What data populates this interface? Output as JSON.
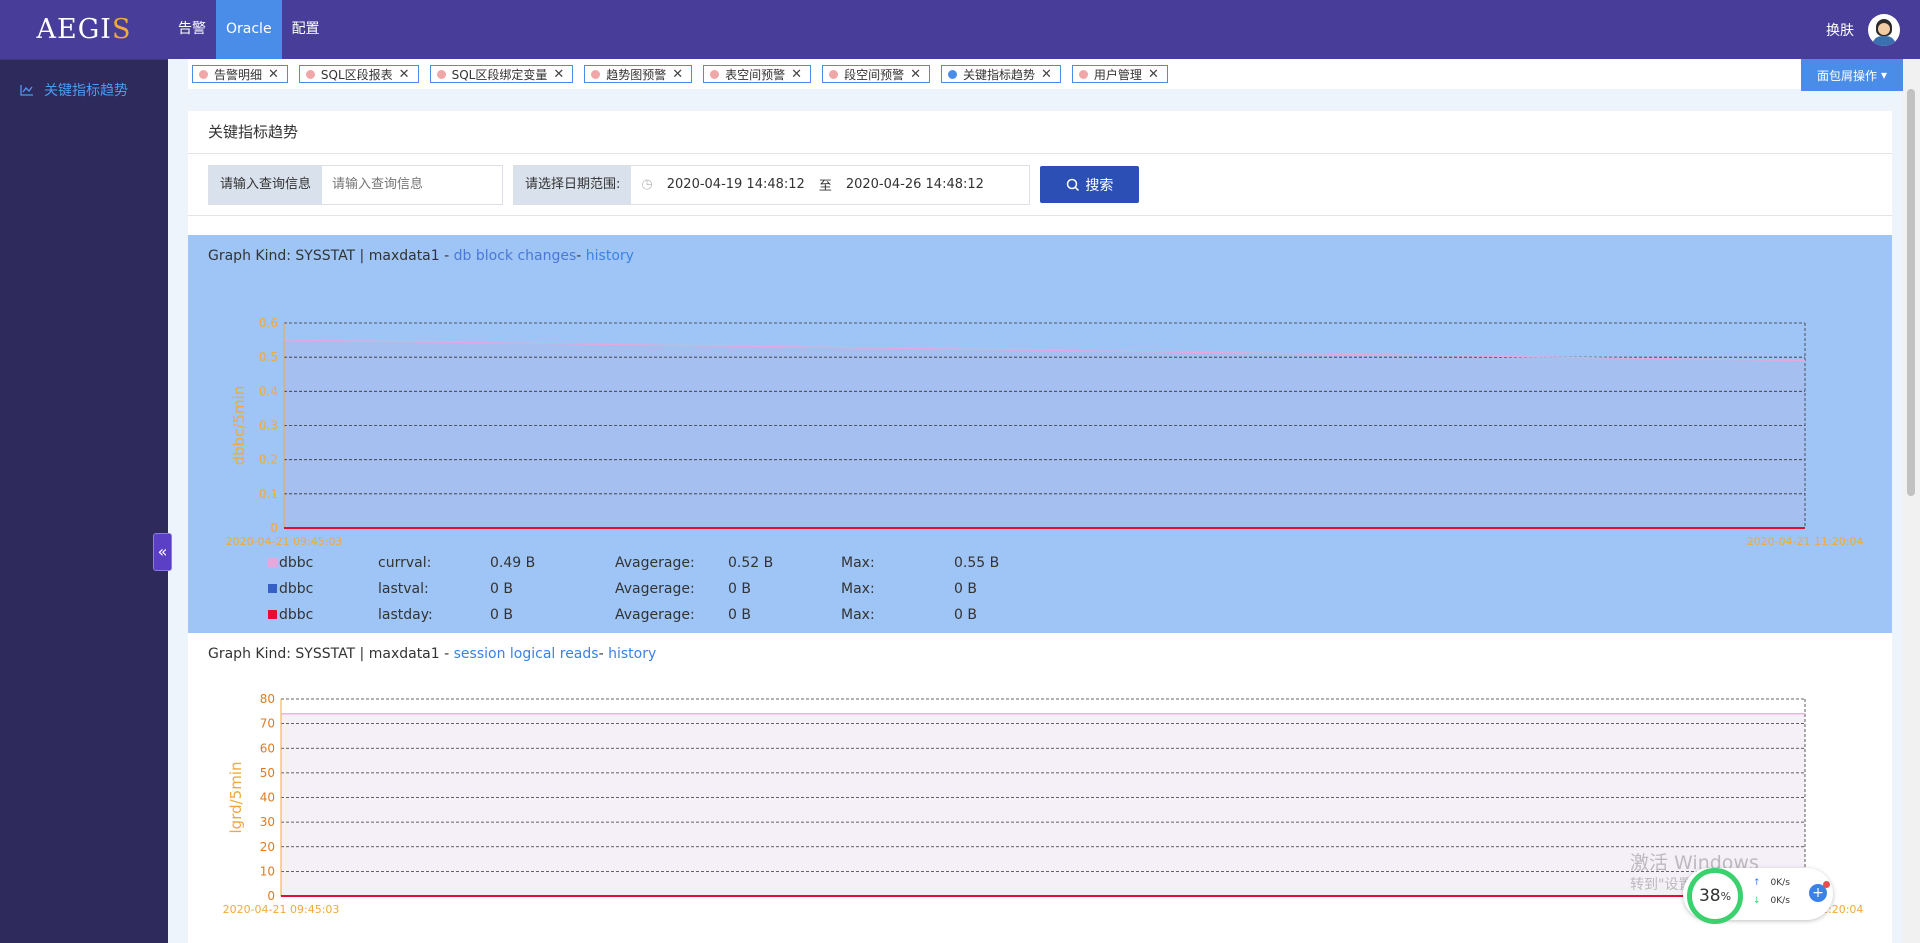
{
  "app": {
    "logo_main": "AEGI",
    "logo_s": "S"
  },
  "topnav": {
    "items": [
      {
        "label": "告警",
        "active": false
      },
      {
        "label": "Oracle",
        "active": true
      },
      {
        "label": "配置",
        "active": false
      }
    ],
    "skin_label": "换肤"
  },
  "sidebar": {
    "items": [
      {
        "label": "关键指标趋势",
        "icon": "line-chart-icon"
      }
    ],
    "collapse_glyph": "«"
  },
  "tabs": [
    {
      "label": "告警明细",
      "active": false
    },
    {
      "label": "SQL区段报表",
      "active": false
    },
    {
      "label": "SQL区段绑定变量",
      "active": false
    },
    {
      "label": "趋势图预警",
      "active": false
    },
    {
      "label": "表空间预警",
      "active": false
    },
    {
      "label": "段空间预警",
      "active": false
    },
    {
      "label": "关键指标趋势",
      "active": true
    },
    {
      "label": "用户管理",
      "active": false
    }
  ],
  "tab_close_glyph": "✕",
  "package_button": "面包屑操作",
  "panel": {
    "title": "关键指标趋势",
    "query_label": "请输入查询信息",
    "query_placeholder": "请输入查询信息",
    "date_label": "请选择日期范围:",
    "date_start": "2020-04-19 14:48:12",
    "date_sep": "至",
    "date_end": "2020-04-26 14:48:12",
    "search_button": "搜索"
  },
  "graph1": {
    "prefix": "Graph Kind: SYSSTAT | maxdata1 - ",
    "metric": "db block changes",
    "dash": "- ",
    "history": "history",
    "legend": [
      {
        "name": "dbbc",
        "color": "#e6a9d9",
        "k1": "currval:",
        "v1": "0.49 B",
        "k2": "Avagerage:",
        "v2": "0.52 B",
        "k3": "Max:",
        "v3": "0.55 B"
      },
      {
        "name": "dbbc",
        "color": "#3560c8",
        "k1": "lastval:",
        "v1": "0 B",
        "k2": "Avagerage:",
        "v2": "0 B",
        "k3": "Max:",
        "v3": "0 B"
      },
      {
        "name": "dbbc",
        "color": "#e0102e",
        "k1": "lastday:",
        "v1": "0 B",
        "k2": "Avagerage:",
        "v2": "0 B",
        "k3": "Max:",
        "v3": "0 B"
      }
    ]
  },
  "graph2": {
    "prefix": "Graph Kind: SYSSTAT | maxdata1 - ",
    "metric": "session logical reads",
    "dash": "- ",
    "history": "history"
  },
  "chart_data": [
    {
      "type": "line",
      "ylabel": "dbbc/5min",
      "ylim": [
        0,
        0.6
      ],
      "yticks": [
        "0",
        "0.1",
        "0.2",
        "0.3",
        "0.4",
        "0.5",
        "0.6"
      ],
      "x_start": "2020-04-21 09:45:03",
      "x_end": "2020-04-21 11:20:04",
      "grid": true,
      "series": [
        {
          "name": "dbbc",
          "color": "#e6a9d9",
          "x": [
            "2020-04-21 09:45:03",
            "2020-04-21 11:20:04"
          ],
          "values": [
            0.55,
            0.49
          ]
        },
        {
          "name": "dbbc",
          "color": "#3560c8",
          "x": [
            "2020-04-21 09:45:03",
            "2020-04-21 11:20:04"
          ],
          "values": [
            0,
            0
          ]
        },
        {
          "name": "dbbc",
          "color": "#e0102e",
          "x": [
            "2020-04-21 09:45:03",
            "2020-04-21 11:20:04"
          ],
          "values": [
            0,
            0
          ]
        }
      ]
    },
    {
      "type": "line",
      "ylabel": "lgrd/5min",
      "ylim": [
        0,
        80
      ],
      "yticks": [
        "0",
        "10",
        "20",
        "30",
        "40",
        "50",
        "60",
        "70",
        "80"
      ],
      "x_start": "2020-04-21 09:45:03",
      "x_end": "2020-04-21 11:20:04",
      "grid": true,
      "series": [
        {
          "color": "#e6a9d9",
          "x": [
            "2020-04-21 09:45:03",
            "2020-04-21 11:20:04"
          ],
          "values": [
            74,
            74
          ]
        },
        {
          "color": "#3560c8",
          "x": [
            "2020-04-21 09:45:03",
            "2020-04-21 11:20:04"
          ],
          "values": [
            0,
            0
          ]
        },
        {
          "color": "#e0102e",
          "x": [
            "2020-04-21 09:45:03",
            "2020-04-21 11:20:04"
          ],
          "values": [
            0,
            0
          ]
        }
      ]
    }
  ],
  "overlay": {
    "watermark_line1": "激活 Windows",
    "watermark_line2": "转到\"设置\"以激活 Windows",
    "net_percent": "38",
    "net_percent_unit": "%",
    "net_up": "0K/s",
    "net_down": "0K/s"
  }
}
